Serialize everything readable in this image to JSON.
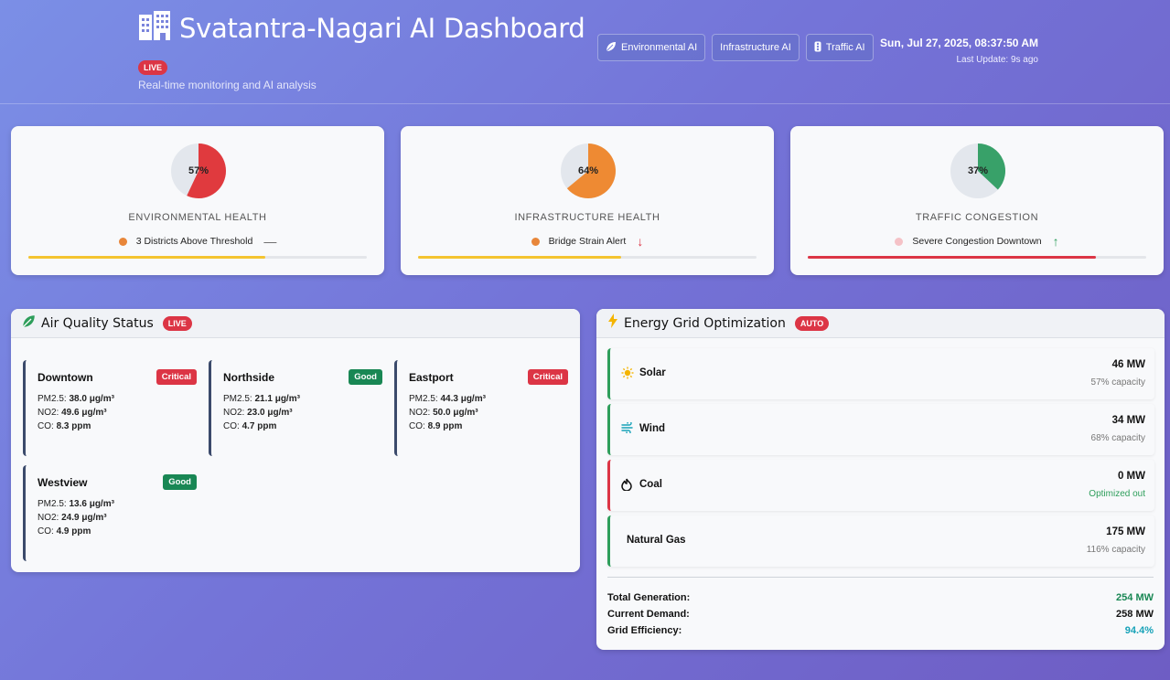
{
  "header": {
    "title": "Svatantra-Nagari AI Dashboard",
    "icon": "city-icon",
    "live": "LIVE",
    "subtitle": "Real-time monitoring and AI analysis",
    "nav": [
      {
        "label": "Environmental AI",
        "icon": "leaf-icon"
      },
      {
        "label": "Infrastructure AI",
        "icon": ""
      },
      {
        "label": "Traffic AI",
        "icon": "traffic-light-icon"
      }
    ],
    "datetime": "Sun, Jul 27, 2025, 08:37:50 AM",
    "last_update": "Last Update: 9s ago"
  },
  "kpis": [
    {
      "value": 57,
      "label": "57%",
      "title": "ENVIRONMENTAL HEALTH",
      "status": "3 Districts Above Threshold",
      "trend": "—",
      "color": "#e03a3e",
      "dot": "#e8863a",
      "trend_color": "#666",
      "bar": 0.7,
      "bar_color": "#f4c430"
    },
    {
      "value": 64,
      "label": "64%",
      "title": "INFRASTRUCTURE HEALTH",
      "status": "Bridge Strain Alert",
      "trend": "↓",
      "color": "#ee8a33",
      "dot": "#e8863a",
      "trend_color": "#dc3545",
      "bar": 0.6,
      "bar_color": "#f4c430"
    },
    {
      "value": 37,
      "label": "37%",
      "title": "TRAFFIC CONGESTION",
      "status": "Severe Congestion Downtown",
      "trend": "↑",
      "color": "#38a169",
      "dot": "#f5c2c7",
      "trend_color": "#2e9e5b",
      "bar": 0.85,
      "bar_color": "#dc3545"
    }
  ],
  "air_quality": {
    "title": "Air Quality Status",
    "badge": "LIVE",
    "districts": [
      {
        "name": "Downtown",
        "status": "Critical",
        "status_color": "#dc3545",
        "pm25_label": "PM2.5:",
        "pm25": "38.0 μg/m³",
        "no2_label": "NO2:",
        "no2": "49.6 μg/m³",
        "co_label": "CO:",
        "co": "8.3 ppm"
      },
      {
        "name": "Northside",
        "status": "Good",
        "status_color": "#198754",
        "pm25_label": "PM2.5:",
        "pm25": "21.1 μg/m³",
        "no2_label": "NO2:",
        "no2": "23.0 μg/m³",
        "co_label": "CO:",
        "co": "4.7 ppm"
      },
      {
        "name": "Eastport",
        "status": "Critical",
        "status_color": "#dc3545",
        "pm25_label": "PM2.5:",
        "pm25": "44.3 μg/m³",
        "no2_label": "NO2:",
        "no2": "50.0 μg/m³",
        "co_label": "CO:",
        "co": "8.9 ppm"
      },
      {
        "name": "Westview",
        "status": "Good",
        "status_color": "#198754",
        "pm25_label": "PM2.5:",
        "pm25": "13.6 μg/m³",
        "no2_label": "NO2:",
        "no2": "24.9 μg/m³",
        "co_label": "CO:",
        "co": "4.9 ppm"
      }
    ]
  },
  "energy": {
    "title": "Energy Grid Optimization",
    "badge": "AUTO",
    "sources": [
      {
        "name": "Solar",
        "icon": "sun-icon",
        "value": "46 MW",
        "sub": "57% capacity",
        "border": "#2e9e5b",
        "sub_color": "#777"
      },
      {
        "name": "Wind",
        "icon": "wind-icon",
        "value": "34 MW",
        "sub": "68% capacity",
        "border": "#2e9e5b",
        "sub_color": "#777"
      },
      {
        "name": "Coal",
        "icon": "fire-icon",
        "value": "0 MW",
        "sub": "Optimized out",
        "border": "#dc3545",
        "sub_color": "#2e9e5b"
      },
      {
        "name": "Natural Gas",
        "icon": "",
        "value": "175 MW",
        "sub": "116% capacity",
        "border": "#2e9e5b",
        "sub_color": "#777"
      }
    ],
    "summary": [
      {
        "label": "Total Generation:",
        "value": "254 MW",
        "color": "#198754"
      },
      {
        "label": "Current Demand:",
        "value": "258 MW",
        "color": "#111111"
      },
      {
        "label": "Grid Efficiency:",
        "value": "94.4%",
        "color": "#17a2b8"
      }
    ]
  }
}
